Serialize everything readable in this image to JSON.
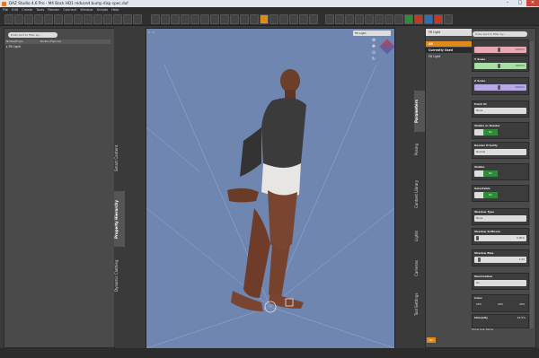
{
  "window": {
    "title": "DAZ Studio 4.6 Pro - M4 Back HD1 reduced bump disp spec.duf",
    "min": "–",
    "max": "□",
    "close": "✕"
  },
  "menu": [
    "File",
    "Edit",
    "Create",
    "Tools",
    "Render",
    "Connect",
    "Window",
    "Scripts",
    "Help"
  ],
  "left": {
    "search_placeholder": "Enter text to filter by...",
    "col_nodes": "Nodes/Props",
    "col_figures": "Nodes (Figures)",
    "tree_item": "▸ Fill Light",
    "tabs": [
      "Smart Content",
      "Property Hierarchy",
      "Dynamic Clothing"
    ]
  },
  "viewport": {
    "camera": "Fill Light",
    "label": "1 : 4"
  },
  "right": {
    "node_select": "Fill Light",
    "nav": {
      "all": "All",
      "currently_used": "Currently Used",
      "fill_light": "Fill Light"
    },
    "search_placeholder": "Enter text to filter by...",
    "tabs": [
      "Parameters",
      "Posing",
      "Content Library",
      "Lights",
      "Cameras",
      "Tool Settings"
    ],
    "props": {
      "x_scale": {
        "label": "X Scale",
        "value": "100.0%"
      },
      "y_scale": {
        "label": "Y Scale",
        "value": "100.0%"
      },
      "z_scale": {
        "label": "Z Scale",
        "value": "100.0%"
      },
      "point_at": {
        "label": "Point At",
        "value": "None"
      },
      "visible_render": {
        "label": "Visible in Render",
        "value": "On"
      },
      "render_priority": {
        "label": "Render Priority",
        "value": "Normal"
      },
      "visible": {
        "label": "Visible",
        "value": "On"
      },
      "selectable": {
        "label": "Selectable",
        "value": "On"
      },
      "shadow_type": {
        "label": "Shadow Type",
        "value": "None"
      },
      "shadow_softness": {
        "label": "Shadow Softness",
        "value": "0.00%"
      },
      "shadow_bias": {
        "label": "Shadow Bias",
        "value": "1.00"
      },
      "illumination": {
        "label": "Illumination",
        "value": "On"
      },
      "color": {
        "label": "Color",
        "r": "255",
        "g": "255",
        "b": "255"
      },
      "intensity": {
        "label": "Intensity",
        "value": "15.0%"
      }
    },
    "show_sub": "Show Sub Items",
    "go": "Go"
  }
}
